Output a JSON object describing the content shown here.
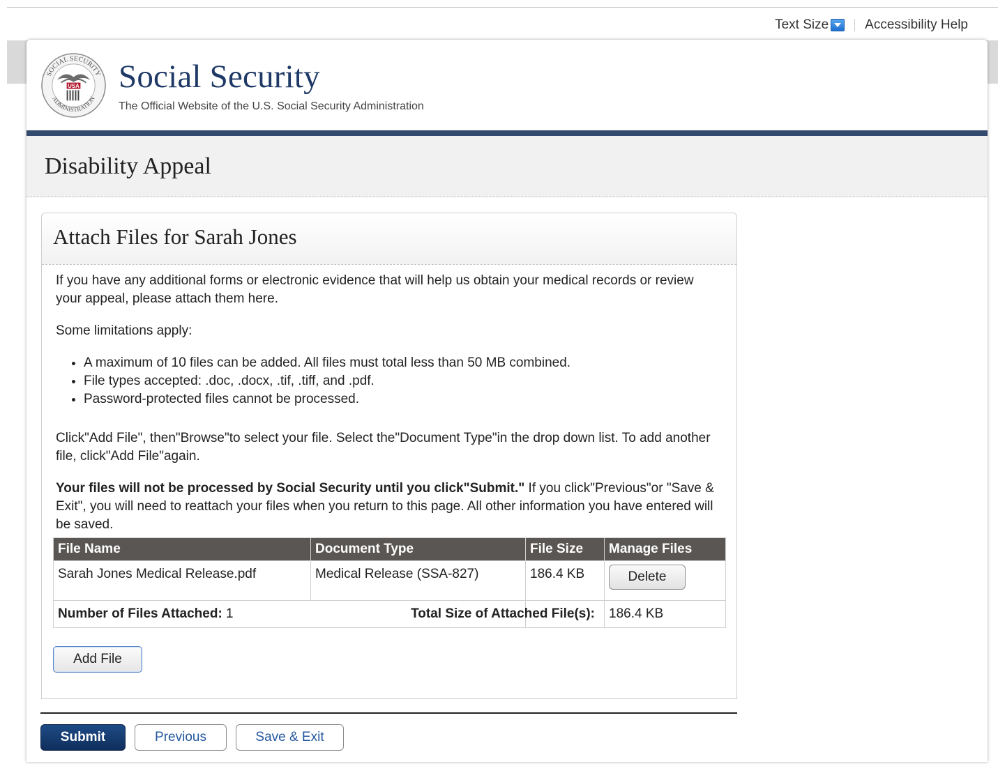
{
  "utility": {
    "text_size_label": "Text Size",
    "accessibility_label": "Accessibility Help"
  },
  "header": {
    "site_title": "Social Security",
    "site_subtitle": "The Official Website of the U.S. Social Security Administration",
    "seal_text_top": "SOCIAL SECURITY",
    "seal_text_bottom": "ADMINISTRATION",
    "seal_badge": "USA"
  },
  "page": {
    "title": "Disability Appeal"
  },
  "panel": {
    "title": "Attach Files for Sarah Jones",
    "intro": "If you have any additional forms or electronic evidence that will help us obtain your medical records or review your appeal, please attach them here.",
    "limitations_heading": "Some limitations apply:",
    "bullets": [
      "A maximum of 10 files can be added. All files must total less than 50 MB combined.",
      "File types accepted: .doc, .docx, .tif, .tiff, and .pdf.",
      "Password-protected files cannot be processed."
    ],
    "instructions": "Click\"Add File\", then\"Browse\"to select your file. Select the\"Document Type\"in the drop down list. To add another file, click\"Add File\"again.",
    "warning_bold": "Your files will not be processed by Social Security until you click\"Submit.\"",
    "warning_rest": " If you click\"Previous\"or \"Save & Exit\", you will need to reattach your files when you return to this page. All other information you have entered will be saved."
  },
  "table": {
    "headers": [
      "File Name",
      "Document Type",
      "File Size",
      "Manage Files"
    ],
    "rows": [
      {
        "file_name": "Sarah Jones Medical Release.pdf",
        "document_type": "Medical Release (SSA-827)",
        "file_size": "186.4 KB",
        "action_label": "Delete"
      }
    ],
    "files_attached_label": "Number of Files Attached:",
    "files_attached_value": "1",
    "total_size_label": "Total Size of Attached File(s):",
    "total_size_value": "186.4 KB"
  },
  "buttons": {
    "add_file": "Add File",
    "submit": "Submit",
    "previous": "Previous",
    "save_exit": "Save & Exit"
  },
  "colors": {
    "brand_navy": "#1e3966",
    "nav_rule": "#334a6e",
    "table_header": "#5a5653",
    "link_blue": "#2457a0"
  }
}
